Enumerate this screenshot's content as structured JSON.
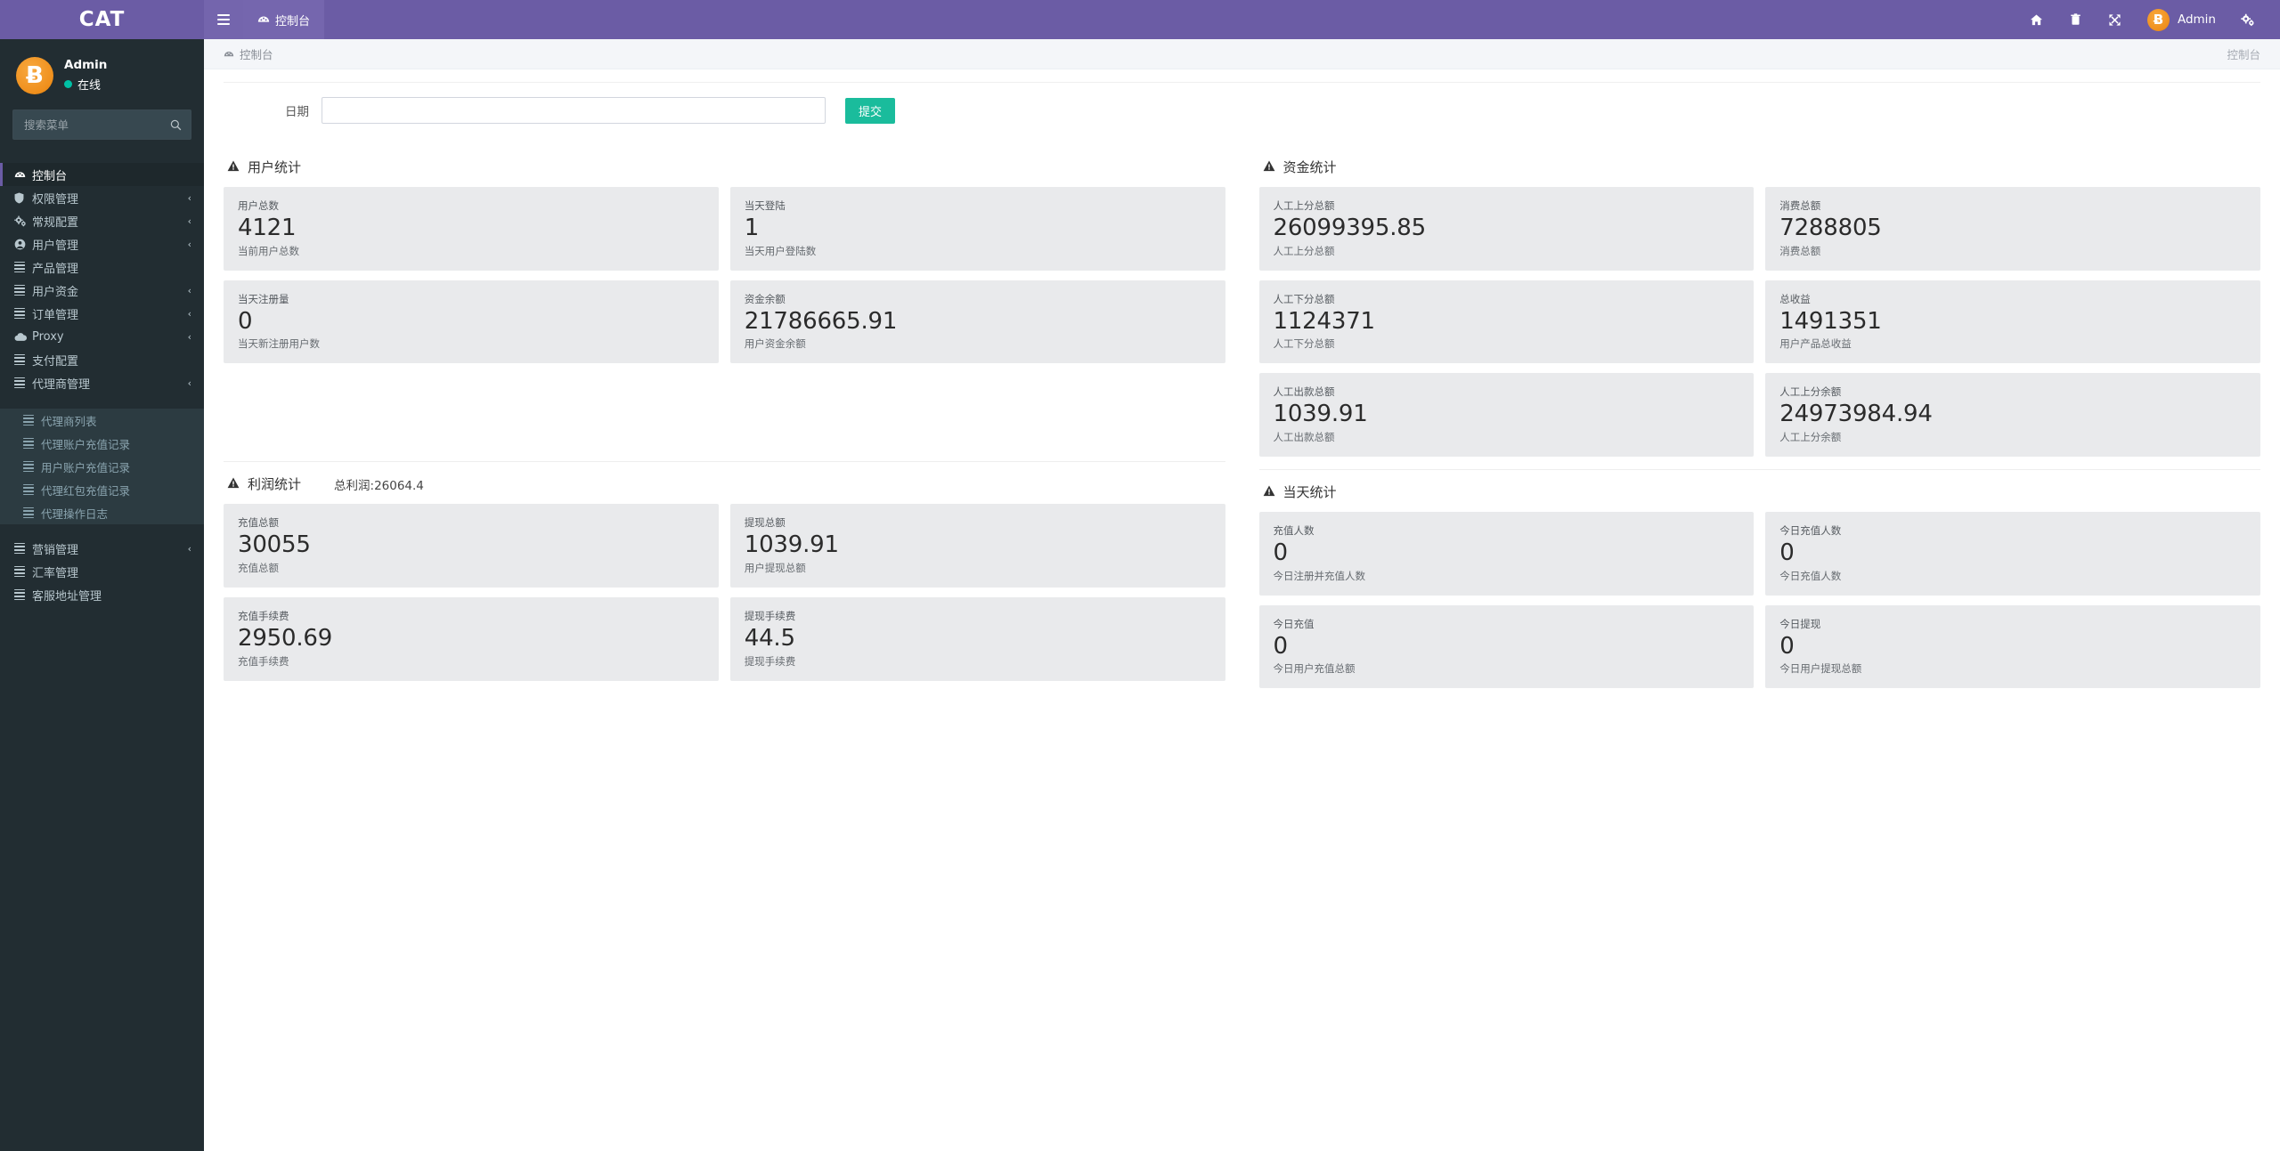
{
  "brand": {
    "title": "CAT"
  },
  "sidebar": {
    "user": {
      "name": "Admin",
      "status": "在线",
      "avatar_glyph": "Ƀ"
    },
    "search": {
      "placeholder": "搜索菜单"
    },
    "items": [
      {
        "label": "控制台",
        "icon": "dashboard-icon",
        "active": true,
        "arrow": false
      },
      {
        "label": "权限管理",
        "icon": "shield-icon",
        "active": false,
        "arrow": true
      },
      {
        "label": "常规配置",
        "icon": "gears-icon",
        "active": false,
        "arrow": true
      },
      {
        "label": "用户管理",
        "icon": "user-circle-icon",
        "active": false,
        "arrow": true
      },
      {
        "label": "产品管理",
        "icon": "bars-icon",
        "active": false,
        "arrow": false
      },
      {
        "label": "用户资金",
        "icon": "bars-icon",
        "active": false,
        "arrow": true
      },
      {
        "label": "订单管理",
        "icon": "bars-icon",
        "active": false,
        "arrow": true
      },
      {
        "label": "Proxy",
        "icon": "cloud-icon",
        "active": false,
        "arrow": true
      },
      {
        "label": "支付配置",
        "icon": "bars-icon",
        "active": false,
        "arrow": false
      },
      {
        "label": "代理商管理",
        "icon": "bars-icon",
        "active": false,
        "arrow": true
      }
    ],
    "submenu": [
      {
        "label": "代理商列表",
        "icon": "bars-icon"
      },
      {
        "label": "代理账户充值记录",
        "icon": "bars-icon"
      },
      {
        "label": "用户账户充值记录",
        "icon": "bars-icon"
      },
      {
        "label": "代理红包充值记录",
        "icon": "bars-icon"
      },
      {
        "label": "代理操作日志",
        "icon": "bars-icon"
      }
    ],
    "items_after": [
      {
        "label": "营销管理",
        "icon": "bars-icon",
        "arrow": true
      },
      {
        "label": "汇率管理",
        "icon": "bars-icon",
        "arrow": false
      },
      {
        "label": "客服地址管理",
        "icon": "bars-icon",
        "arrow": false
      }
    ]
  },
  "navbar": {
    "toggle_icon": "hamburger-icon",
    "tab_label": "控制台",
    "tab_icon": "dashboard-icon",
    "home_icon": "home-icon",
    "trash_icon": "trash-icon",
    "fullscreen_icon": "expand-icon",
    "user_label": "Admin",
    "user_avatar_glyph": "Ƀ",
    "settings_icon": "gears-icon"
  },
  "breadcrumb": {
    "icon": "dashboard-icon",
    "current": "控制台",
    "right": "控制台"
  },
  "filter": {
    "label": "日期",
    "value": "",
    "placeholder": "",
    "submit_label": "提交"
  },
  "panels": [
    {
      "id": "user-stats",
      "title": "用户统计",
      "extra": "",
      "tiles": [
        {
          "title": "用户总数",
          "value": "4121",
          "sub": "当前用户总数"
        },
        {
          "title": "当天登陆",
          "value": "1",
          "sub": "当天用户登陆数"
        },
        {
          "title": "当天注册量",
          "value": "0",
          "sub": "当天新注册用户数"
        },
        {
          "title": "资金余额",
          "value": "21786665.91",
          "sub": "用户资金余额"
        }
      ]
    },
    {
      "id": "fund-stats",
      "title": "资金统计",
      "extra": "",
      "tiles": [
        {
          "title": "人工上分总额",
          "value": "26099395.85",
          "sub": "人工上分总额"
        },
        {
          "title": "消费总额",
          "value": "7288805",
          "sub": "消费总额"
        },
        {
          "title": "人工下分总额",
          "value": "1124371",
          "sub": "人工下分总额"
        },
        {
          "title": "总收益",
          "value": "1491351",
          "sub": "用户产品总收益"
        },
        {
          "title": "人工出款总额",
          "value": "1039.91",
          "sub": "人工出款总额"
        },
        {
          "title": "人工上分余额",
          "value": "24973984.94",
          "sub": "人工上分余额"
        }
      ]
    },
    {
      "id": "profit-stats",
      "title": "利润统计",
      "extra": "总利润:26064.4",
      "tiles": [
        {
          "title": "充值总额",
          "value": "30055",
          "sub": "充值总额"
        },
        {
          "title": "提现总额",
          "value": "1039.91",
          "sub": "用户提现总额"
        },
        {
          "title": "充值手续费",
          "value": "2950.69",
          "sub": "充值手续费"
        },
        {
          "title": "提现手续费",
          "value": "44.5",
          "sub": "提现手续费"
        }
      ]
    },
    {
      "id": "today-stats",
      "title": "当天统计",
      "extra": "",
      "tiles": [
        {
          "title": "充值人数",
          "value": "0",
          "sub": "今日注册并充值人数"
        },
        {
          "title": "今日充值人数",
          "value": "0",
          "sub": "今日充值人数"
        },
        {
          "title": "今日充值",
          "value": "0",
          "sub": "今日用户充值总额"
        },
        {
          "title": "今日提现",
          "value": "0",
          "sub": "今日用户提现总额"
        }
      ]
    }
  ],
  "colors": {
    "brand_purple": "#6b5ca5",
    "sidebar_dark": "#222d32",
    "submenu_dark": "#2c3b41",
    "accent_green": "#1abc9c",
    "tile_gray": "#e9eaec",
    "bitcoin_orange": "#ef8f1c",
    "online_green": "#00c0a5"
  }
}
